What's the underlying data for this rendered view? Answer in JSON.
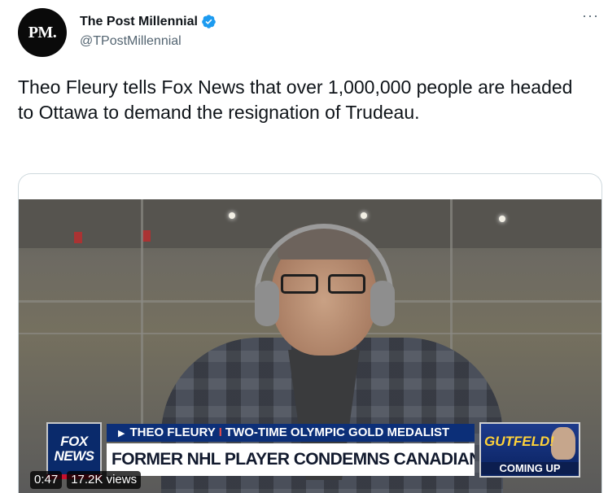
{
  "account": {
    "avatar_text": "PM.",
    "display_name": "The Post Millennial",
    "handle": "@TPostMillennial",
    "verified": true
  },
  "menu": {
    "more_label": "···"
  },
  "tweet": {
    "text": "Theo Fleury tells Fox News that over 1,000,000 people are headed to Ottawa to demand the resignation of Trudeau."
  },
  "video": {
    "chyron": {
      "logo_line1": "FOX",
      "logo_line2": "NEWS",
      "arrow": "▶",
      "name": "THEO FLEURY",
      "separator": "I",
      "title": "TWO-TIME OLYMPIC GOLD MEDALIST",
      "headline": "FORMER NHL PLAYER CONDEMNS CANADIAN COVID RESPONSE",
      "promo_title": "GUTFELD!",
      "promo_subtitle": "COMING UP"
    },
    "timestamp": "0:47",
    "views": "17.2K views"
  },
  "colors": {
    "accent_blue": "#1d9bf0",
    "fox_blue": "#0c2f78",
    "fox_red": "#c8102e",
    "promo_yellow": "#ffd23a"
  }
}
